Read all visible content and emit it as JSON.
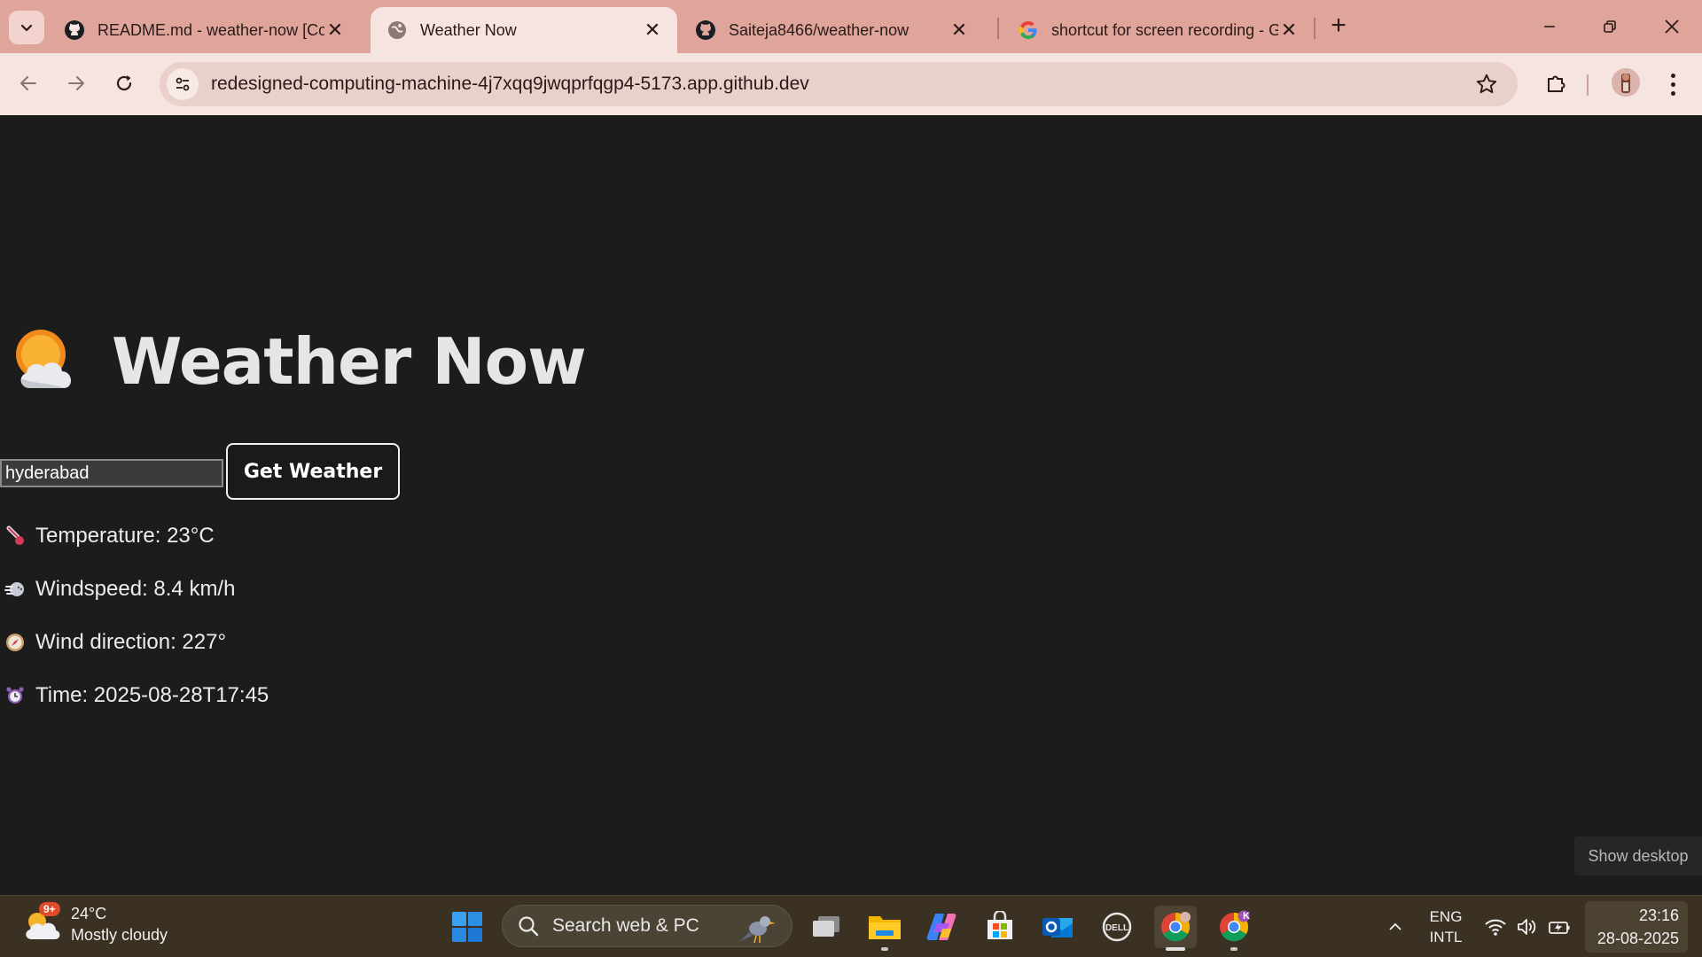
{
  "browser": {
    "tabs": [
      {
        "title": "README.md - weather-now [Co",
        "favicon": "github-icon",
        "active": false
      },
      {
        "title": "Weather Now",
        "favicon": "globe-icon",
        "active": true
      },
      {
        "title": "Saiteja8466/weather-now",
        "favicon": "github-icon",
        "active": false
      },
      {
        "title": "shortcut for screen recording - G",
        "favicon": "google-icon",
        "active": false
      }
    ],
    "new_tab_label": "+",
    "url": "redesigned-computing-machine-4j7xqq9jwqprfqgp4-5173.app.github.dev",
    "accent": "#dfa59b",
    "toolbar_bg": "#f6e4e1"
  },
  "page": {
    "title": "Weather Now",
    "title_icon": "sun-behind-cloud-icon",
    "input": {
      "value": "hyderabad",
      "placeholder": ""
    },
    "button_label": "Get Weather",
    "results": {
      "temperature": "Temperature: 23°C",
      "windspeed": "Windspeed: 8.4 km/h",
      "wind_direction": "Wind direction: 227°",
      "time": "Time: 2025-08-28T17:45"
    },
    "background": "#1c1c1c"
  },
  "overlay": {
    "show_desktop": "Show desktop"
  },
  "taskbar": {
    "weather": {
      "temp": "24°C",
      "condition": "Mostly cloudy",
      "badge": "9+"
    },
    "search_placeholder": "Search web & PC",
    "language": {
      "line1": "ENG",
      "line2": "INTL"
    },
    "clock": {
      "time": "23:16",
      "date": "28-08-2025"
    },
    "profile_badge": "K",
    "apps": [
      "windows-start-icon",
      "task-view-icon",
      "file-explorer-icon",
      "copilot-icon",
      "microsoft-store-icon",
      "outlook-icon",
      "dell-icon",
      "chrome-icon",
      "chrome-profile-icon"
    ]
  }
}
